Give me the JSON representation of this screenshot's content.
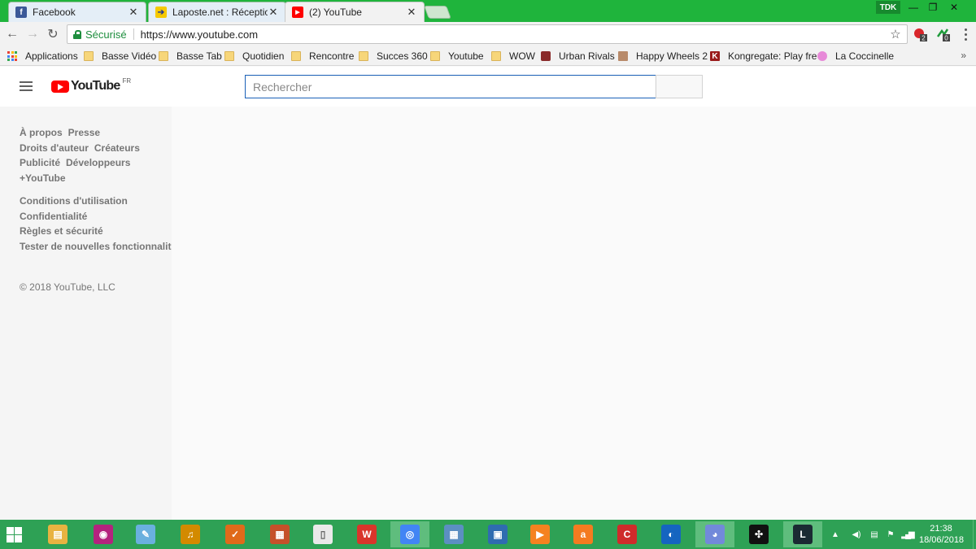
{
  "browser": {
    "tabs": [
      {
        "title": "Facebook",
        "icon": "facebook-icon",
        "color": "#3b5998",
        "glyph": "f",
        "close": "✕"
      },
      {
        "title": "Laposte.net : Réception",
        "icon": "laposte-icon",
        "color": "#f6c900",
        "glyph": "➔",
        "close": "✕"
      },
      {
        "title": "(2) YouTube",
        "icon": "youtube-icon",
        "color": "#ff0000",
        "glyph": "▶",
        "close": "✕"
      }
    ],
    "profile": "TDK",
    "window_controls": {
      "minimize": "—",
      "maximize": "❐",
      "close": "✕"
    },
    "toolbar": {
      "back": "←",
      "forward": "→",
      "reload": "↻",
      "secure_label": "Sécurisé",
      "url": "https://www.youtube.com",
      "star": "☆",
      "ext1_badge": "2",
      "ext2_badge": "0"
    },
    "bookmarks": [
      {
        "label": "Applications",
        "type": "apps"
      },
      {
        "label": "Basse Vidéo",
        "type": "folder"
      },
      {
        "label": "Basse Tab",
        "type": "folder"
      },
      {
        "label": "Quotidien",
        "type": "folder"
      },
      {
        "label": "Rencontre",
        "type": "folder"
      },
      {
        "label": "Succes 360",
        "type": "folder"
      },
      {
        "label": "Youtube",
        "type": "folder"
      },
      {
        "label": "WOW",
        "type": "folder"
      },
      {
        "label": "Urban Rivals",
        "type": "site",
        "color": "#8a2b2b"
      },
      {
        "label": "Happy Wheels 2",
        "type": "site",
        "color": "#b88a6a"
      },
      {
        "label": "Kongregate: Play fre",
        "type": "site",
        "color": "#9a1b1b"
      },
      {
        "label": "La Coccinelle",
        "type": "site",
        "color": "#e78ad8"
      }
    ],
    "bookmarks_overflow": "»"
  },
  "youtube": {
    "logo_text": "YouTube",
    "country": "FR",
    "search_placeholder": "Rechercher",
    "guide_row1": [
      "À propos",
      "Presse"
    ],
    "guide_row2": [
      "Droits d'auteur",
      "Créateurs"
    ],
    "guide_row3": [
      "Publicité",
      "Développeurs"
    ],
    "guide_row4": [
      "+YouTube"
    ],
    "guide_block2": [
      "Conditions d'utilisation",
      "Confidentialité",
      "Règles et sécurité",
      "Tester de nouvelles fonctionnalités"
    ],
    "copyright": "© 2018 YouTube, LLC"
  },
  "taskbar": {
    "apps": [
      {
        "name": "file-explorer",
        "color": "#e8b341",
        "glyph": "▤"
      },
      {
        "name": "camera-app",
        "color": "#b4237e",
        "glyph": "◉"
      },
      {
        "name": "paint-app",
        "color": "#6ab0de",
        "glyph": "✎"
      },
      {
        "name": "audio-app",
        "color": "#d38a00",
        "glyph": "♫"
      },
      {
        "name": "tasks-app",
        "color": "#e06a1a",
        "glyph": "✓"
      },
      {
        "name": "video-editor-app",
        "color": "#c5512a",
        "glyph": "▦"
      },
      {
        "name": "document-app",
        "color": "#e9e9e9",
        "glyph": "▯"
      },
      {
        "name": "office-app",
        "color": "#d9352b",
        "glyph": "W"
      },
      {
        "name": "chrome-app",
        "color": "#4285f4",
        "glyph": "◎",
        "active": true
      },
      {
        "name": "calculator-app",
        "color": "#5c8fc2",
        "glyph": "▦"
      },
      {
        "name": "network-app",
        "color": "#2f6cb0",
        "glyph": "▣"
      },
      {
        "name": "media-player-app",
        "color": "#f58220",
        "glyph": "▶"
      },
      {
        "name": "avast-app",
        "color": "#f47b20",
        "glyph": "a"
      },
      {
        "name": "ccleaner-app",
        "color": "#cf2b2b",
        "glyph": "C"
      },
      {
        "name": "circle-app",
        "color": "#1565c0",
        "glyph": "◐"
      },
      {
        "name": "discord-app",
        "color": "#7289da",
        "glyph": "◕",
        "active": true
      },
      {
        "name": "overwolf-app",
        "color": "#111111",
        "glyph": "✣"
      },
      {
        "name": "league-app",
        "color": "#1b2a33",
        "glyph": "L",
        "active": true
      }
    ],
    "tray_icons": [
      "▲",
      "◀)",
      "▤",
      "⚑",
      "▂▄▆"
    ],
    "time": "21:38",
    "date": "18/06/2018"
  }
}
